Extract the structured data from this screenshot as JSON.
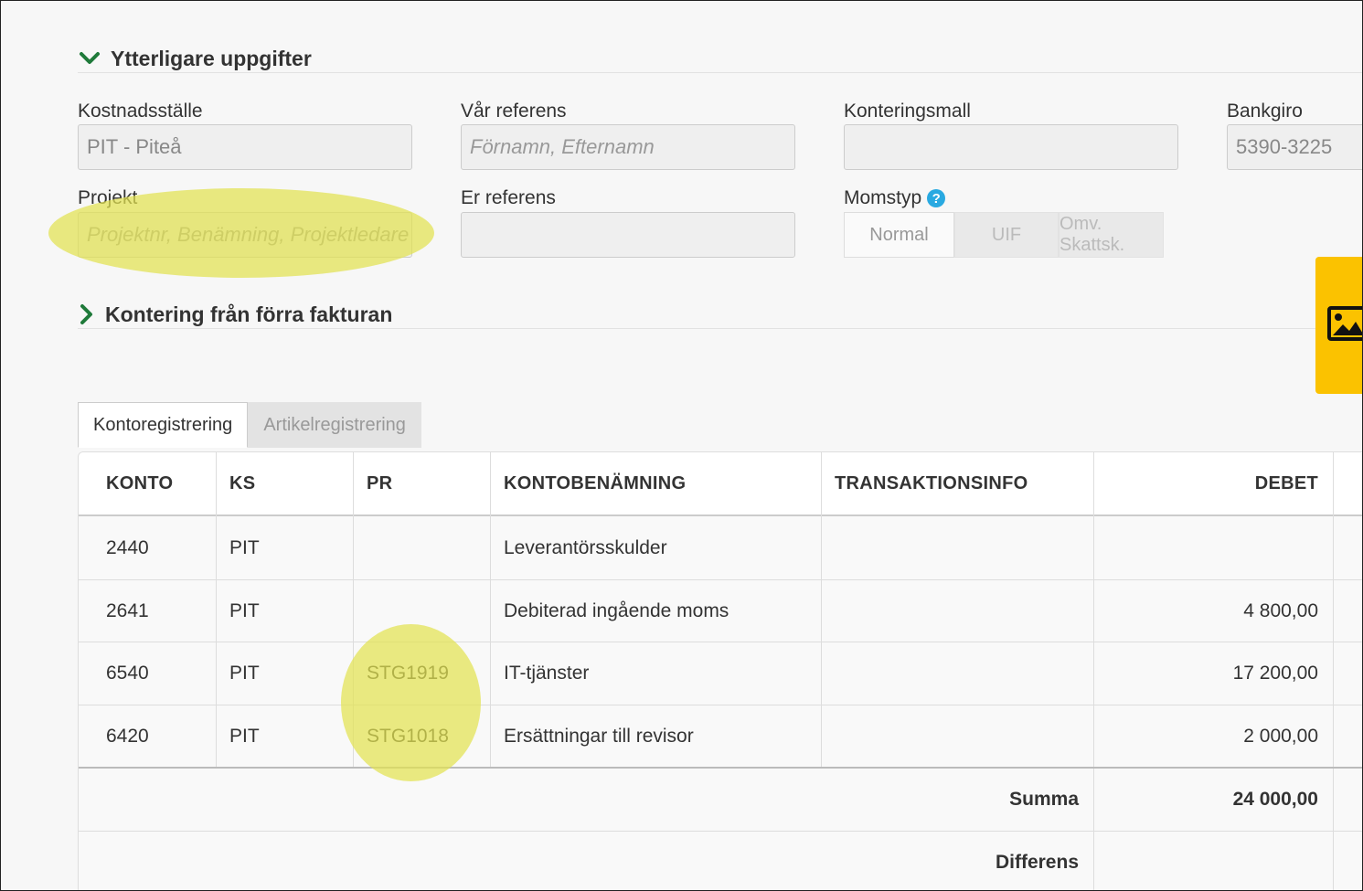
{
  "sections": {
    "extra": {
      "title": "Ytterligare uppgifter",
      "expanded": true
    },
    "kontering": {
      "title": "Kontering från förra fakturan",
      "expanded": false
    }
  },
  "fields": {
    "kostnadsstalle": {
      "label": "Kostnadsställe",
      "value": "PIT - Piteå"
    },
    "var_referens": {
      "label": "Vår referens",
      "placeholder": "Förnamn, Efternamn"
    },
    "konteringsmall": {
      "label": "Konteringsmall",
      "value": ""
    },
    "bankgiro": {
      "label": "Bankgiro",
      "value": "5390-3225"
    },
    "projekt": {
      "label": "Projekt",
      "placeholder": "Projektnr, Benämning, Projektledare"
    },
    "er_referens": {
      "label": "Er referens",
      "value": ""
    },
    "momstyp": {
      "label": "Momstyp",
      "help": "?",
      "options": [
        "Normal",
        "UIF",
        "Omv. Skattsk."
      ],
      "selected": "Normal"
    }
  },
  "tabs": [
    {
      "label": "Kontoregistrering",
      "active": true
    },
    {
      "label": "Artikelregistrering",
      "active": false
    }
  ],
  "table": {
    "headers": [
      "KONTO",
      "KS",
      "PR",
      "KONTOBENÄMNING",
      "TRANSAKTIONSINFO",
      "DEBET"
    ],
    "rows": [
      {
        "konto": "2440",
        "ks": "PIT",
        "pr": "",
        "benamning": "Leverantörsskulder",
        "info": "",
        "debet": ""
      },
      {
        "konto": "2641",
        "ks": "PIT",
        "pr": "",
        "benamning": "Debiterad ingående moms",
        "info": "",
        "debet": "4 800,00"
      },
      {
        "konto": "6540",
        "ks": "PIT",
        "pr": "STG1919",
        "benamning": "IT-tjänster",
        "info": "",
        "debet": "17 200,00"
      },
      {
        "konto": "6420",
        "ks": "PIT",
        "pr": "STG1018",
        "benamning": "Ersättningar till revisor",
        "info": "",
        "debet": "2 000,00"
      }
    ],
    "summa": {
      "label": "Summa",
      "value": "24 000,00"
    },
    "differens": {
      "label": "Differens",
      "value": ""
    }
  },
  "colors": {
    "accent_green": "#1f7a3a",
    "help_blue": "#29a9e1",
    "side_tab_yellow": "#fbc200",
    "highlight": "#e2e250"
  },
  "icons": {
    "section_open": "chevron-down-icon",
    "section_closed": "chevron-right-icon",
    "help": "question-circle-icon",
    "side_tab": "image-icon"
  }
}
